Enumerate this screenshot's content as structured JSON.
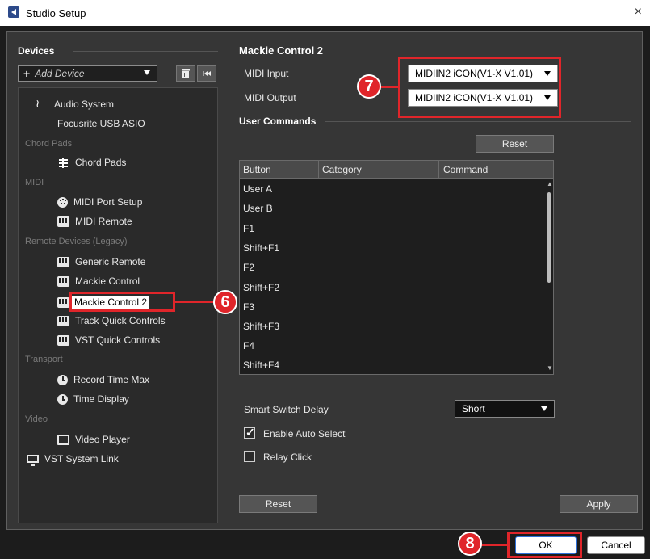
{
  "window": {
    "title": "Studio Setup",
    "close": "×"
  },
  "left": {
    "heading": "Devices",
    "add_device": {
      "plus": "+",
      "label": "Add Device"
    },
    "tree": {
      "audio_system": "Audio System",
      "focusrite": "Focusrite USB ASIO",
      "cat_chord": "Chord Pads",
      "chord_pads": "Chord Pads",
      "cat_midi": "MIDI",
      "midi_port_setup": "MIDI Port Setup",
      "midi_remote": "MIDI Remote",
      "cat_remote": "Remote Devices (Legacy)",
      "generic_remote": "Generic Remote",
      "mackie_control": "Mackie Control",
      "mackie_control_2": "Mackie Control 2",
      "track_quick": "Track Quick Controls",
      "vst_quick": "VST Quick Controls",
      "cat_transport": "Transport",
      "record_time_max": "Record Time Max",
      "time_display": "Time Display",
      "cat_video": "Video",
      "video_player": "Video Player",
      "vst_system_link": "VST System Link"
    }
  },
  "right": {
    "title": "Mackie Control 2",
    "midi_input_label": "MIDI Input",
    "midi_input_value": "MIDIIN2 iCON(V1-X V1.01)",
    "midi_output_label": "MIDI Output",
    "midi_output_value": "MIDIIN2 iCON(V1-X V1.01)",
    "user_commands": "User Commands",
    "reset_top": "Reset",
    "table": {
      "columns": [
        "Button",
        "Category",
        "Command"
      ],
      "rows": [
        "User A",
        "User B",
        "F1",
        "Shift+F1",
        "F2",
        "Shift+F2",
        "F3",
        "Shift+F3",
        "F4",
        "Shift+F4"
      ]
    },
    "smart_switch_label": "Smart Switch Delay",
    "smart_switch_value": "Short",
    "enable_auto_select": "Enable Auto Select",
    "relay_click": "Relay Click",
    "reset_bottom": "Reset",
    "apply": "Apply"
  },
  "footer": {
    "ok": "OK",
    "cancel": "Cancel"
  },
  "annotations": {
    "six": "6",
    "seven": "7",
    "eight": "8"
  },
  "colors": {
    "highlight_red": "#e0252a",
    "panel": "#363636"
  }
}
